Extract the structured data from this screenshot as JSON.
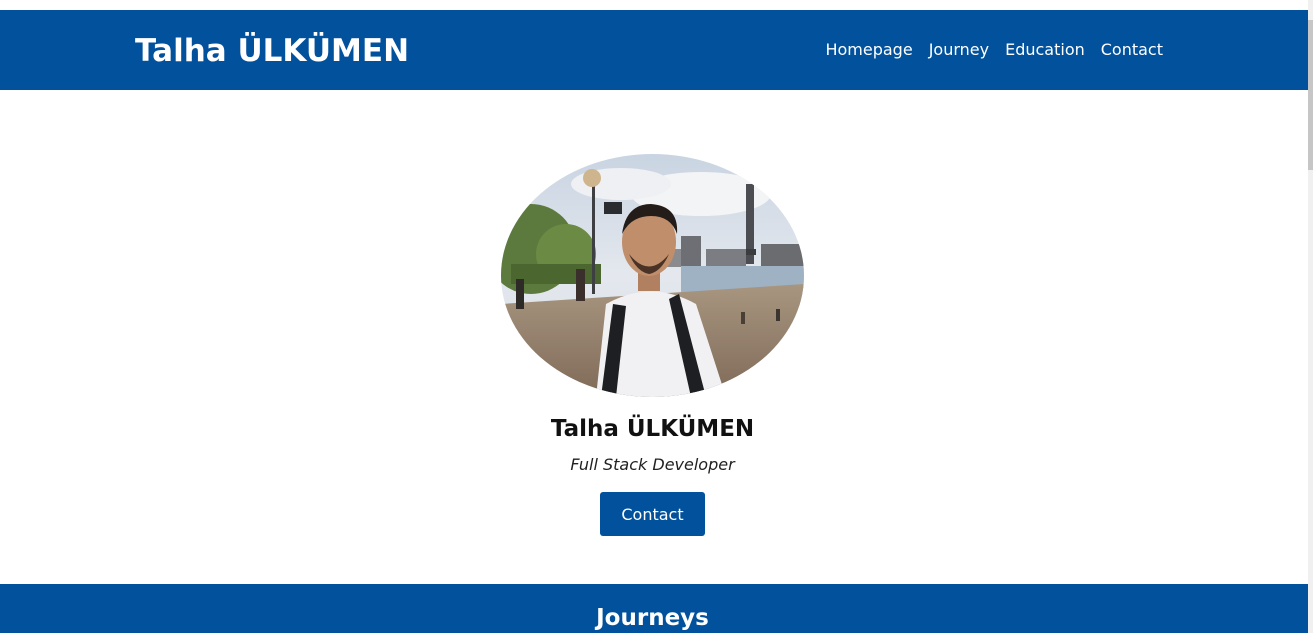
{
  "header": {
    "brand": "Talha ÜLKÜMEN",
    "nav": [
      {
        "label": "Homepage"
      },
      {
        "label": "Journey"
      },
      {
        "label": "Education"
      },
      {
        "label": "Contact"
      }
    ]
  },
  "hero": {
    "name": "Talha ÜLKÜMEN",
    "title": "Full Stack Developer",
    "contact_button": "Contact"
  },
  "section": {
    "title": "Journeys"
  },
  "colors": {
    "primary": "#02519c",
    "background": "#ffffff"
  },
  "icons": {
    "profile_photo": "profile-photo"
  }
}
